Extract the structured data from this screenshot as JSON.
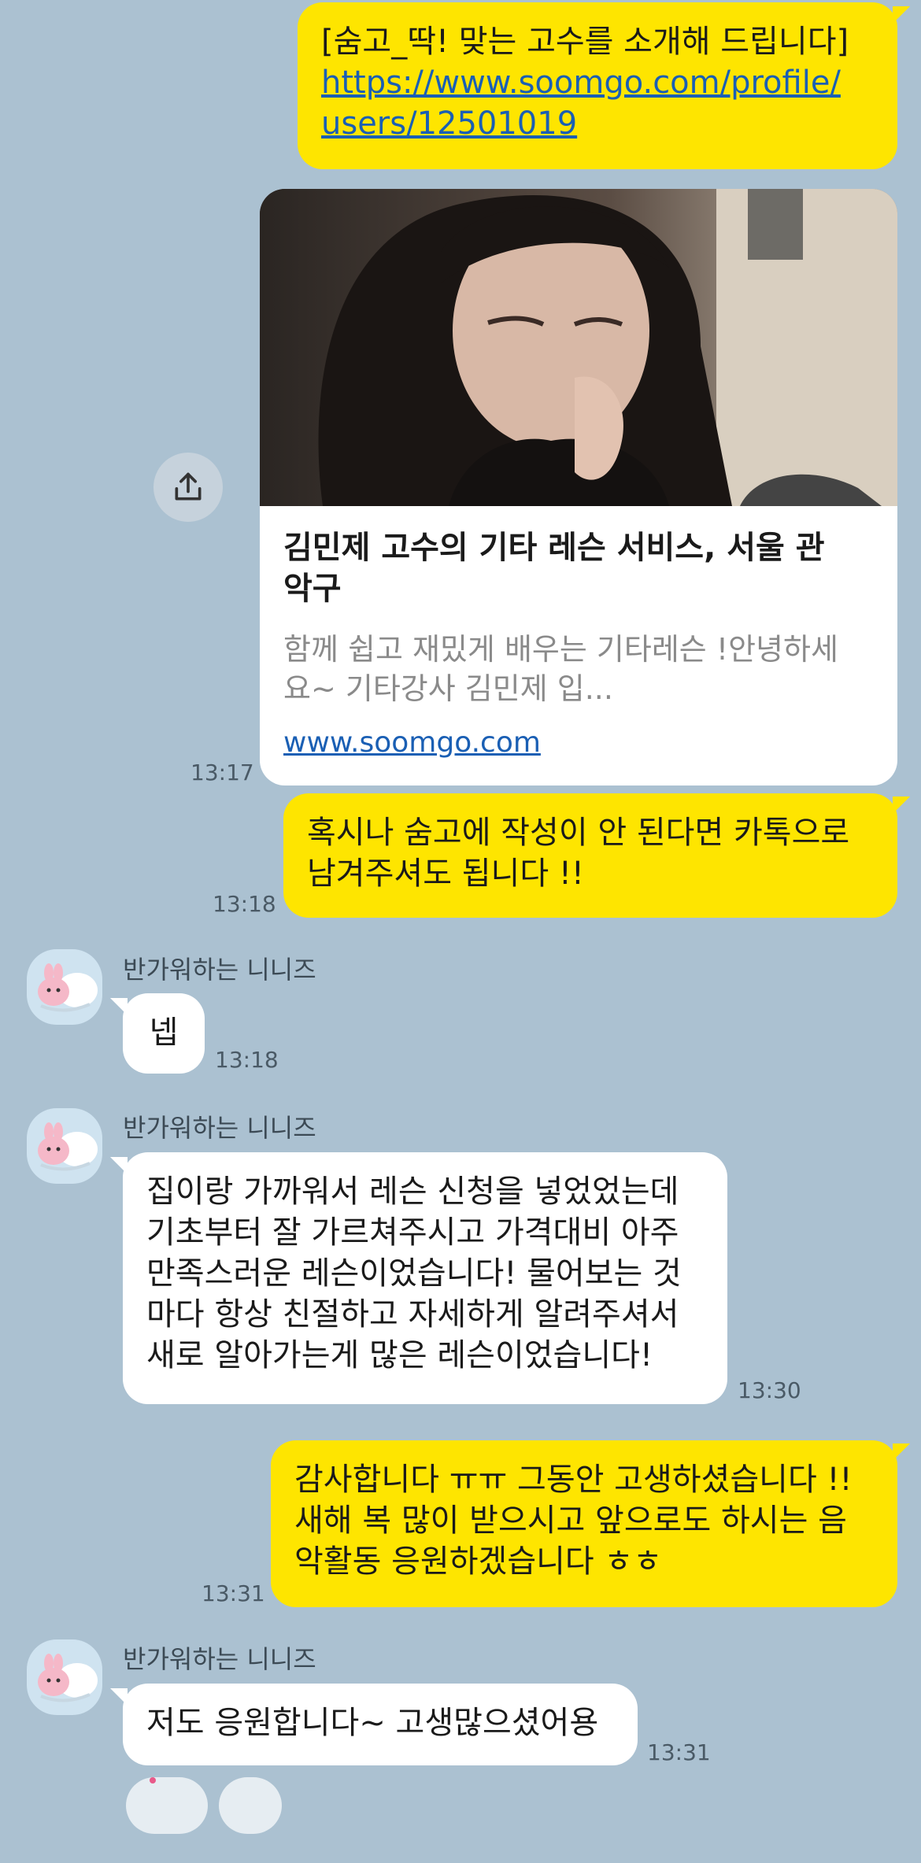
{
  "messages": {
    "m1": {
      "line1": "[숨고_딱! 맞는 고수를 소개해 드립니다]",
      "link_line1": "https://www.soomgo.com/profile/",
      "link_line2": "users/12501019"
    },
    "card": {
      "title_line1": "김민제 고수의 기타 레슨 서비스, 서울 관",
      "title_line2": "악구",
      "desc_line1": "함께 쉽고 재밌게 배우는 기타레슨 !안녕하세",
      "desc_line2": "요~ 기타강사 김민제 입...",
      "domain": "www.soomgo.com",
      "time": "13:17"
    },
    "m2": {
      "line1": "혹시나 숨고에 작성이 안 된다면 카톡으로",
      "line2": "남겨주셔도 됩니다 !!",
      "time": "13:18"
    },
    "m3": {
      "sender": "반가워하는 니니즈",
      "text": "넵",
      "time": "13:18"
    },
    "m4": {
      "sender": "반가워하는 니니즈",
      "line1": "집이랑 가까워서 레슨 신청을 넣었었는데",
      "line2": "기초부터 잘 가르쳐주시고 가격대비 아주",
      "line3": "만족스러운 레슨이었습니다! 물어보는 것",
      "line4": "마다 항상 친절하고 자세하게 알려주셔서",
      "line5": "새로 알아가는게 많은 레슨이었습니다!",
      "time": "13:30"
    },
    "m5": {
      "line1": "감사합니다 ㅠㅠ 그동안 고생하셨습니다 !!",
      "line2": "새해 복 많이 받으시고 앞으로도 하시는 음",
      "line3": "악활동 응원하겠습니다 ㅎㅎ",
      "time": "13:31"
    },
    "m6": {
      "sender": "반가워하는 니니즈",
      "text": "저도 응원합니다~ 고생많으셨어용",
      "time": "13:31"
    }
  },
  "icons": {
    "share": "share-icon",
    "avatar": "ninis-sticker-avatar"
  },
  "colors": {
    "background": "#abc1d1",
    "my_bubble": "#fee500",
    "other_bubble": "#ffffff",
    "link": "#1a5fb4"
  }
}
